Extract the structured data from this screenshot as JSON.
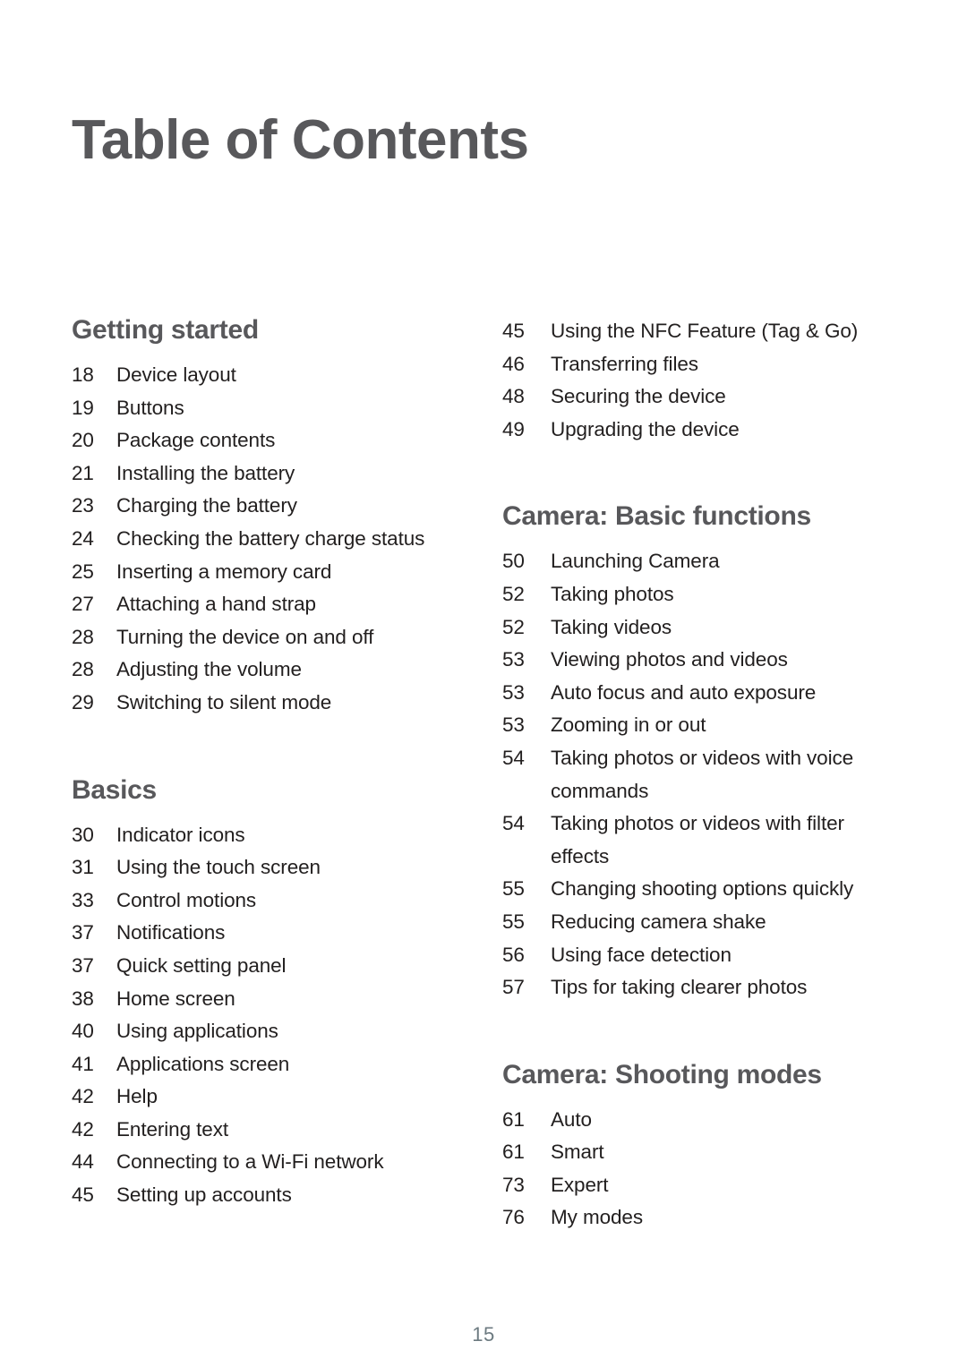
{
  "document": {
    "title": "Table of Contents",
    "folio": "15",
    "colors": {
      "heading": "#58585b",
      "body": "#221f1f",
      "folio": "#6c7a80",
      "background": "#ffffff"
    }
  },
  "columns": {
    "left": [
      {
        "heading": "Getting started",
        "entries": [
          {
            "page": "18",
            "label": "Device layout"
          },
          {
            "page": "19",
            "label": "Buttons"
          },
          {
            "page": "20",
            "label": "Package contents"
          },
          {
            "page": "21",
            "label": "Installing the battery"
          },
          {
            "page": "23",
            "label": "Charging the battery"
          },
          {
            "page": "24",
            "label": "Checking the battery charge status"
          },
          {
            "page": "25",
            "label": "Inserting a memory card"
          },
          {
            "page": "27",
            "label": "Attaching a hand strap"
          },
          {
            "page": "28",
            "label": "Turning the device on and off"
          },
          {
            "page": "28",
            "label": "Adjusting the volume"
          },
          {
            "page": "29",
            "label": "Switching to silent mode"
          }
        ]
      },
      {
        "heading": "Basics",
        "entries": [
          {
            "page": "30",
            "label": "Indicator icons"
          },
          {
            "page": "31",
            "label": "Using the touch screen"
          },
          {
            "page": "33",
            "label": "Control motions"
          },
          {
            "page": "37",
            "label": "Notifications"
          },
          {
            "page": "37",
            "label": "Quick setting panel"
          },
          {
            "page": "38",
            "label": "Home screen"
          },
          {
            "page": "40",
            "label": "Using applications"
          },
          {
            "page": "41",
            "label": "Applications screen"
          },
          {
            "page": "42",
            "label": "Help"
          },
          {
            "page": "42",
            "label": "Entering text"
          },
          {
            "page": "44",
            "label": "Connecting to a Wi-Fi network"
          },
          {
            "page": "45",
            "label": "Setting up accounts"
          }
        ]
      }
    ],
    "right": [
      {
        "heading": "",
        "entries": [
          {
            "page": "45",
            "label": "Using the NFC Feature (Tag & Go)"
          },
          {
            "page": "46",
            "label": "Transferring files"
          },
          {
            "page": "48",
            "label": "Securing the device"
          },
          {
            "page": "49",
            "label": "Upgrading the device"
          }
        ]
      },
      {
        "heading": "Camera: Basic functions",
        "entries": [
          {
            "page": "50",
            "label": "Launching Camera"
          },
          {
            "page": "52",
            "label": "Taking photos"
          },
          {
            "page": "52",
            "label": "Taking videos"
          },
          {
            "page": "53",
            "label": "Viewing photos and videos"
          },
          {
            "page": "53",
            "label": "Auto focus and auto exposure"
          },
          {
            "page": "53",
            "label": "Zooming in or out"
          },
          {
            "page": "54",
            "label": "Taking photos or videos with voice commands"
          },
          {
            "page": "54",
            "label": "Taking photos or videos with filter effects"
          },
          {
            "page": "55",
            "label": "Changing shooting options quickly"
          },
          {
            "page": "55",
            "label": "Reducing camera shake"
          },
          {
            "page": "56",
            "label": "Using face detection"
          },
          {
            "page": "57",
            "label": "Tips for taking clearer photos"
          }
        ]
      },
      {
        "heading": "Camera: Shooting modes",
        "entries": [
          {
            "page": "61",
            "label": "Auto"
          },
          {
            "page": "61",
            "label": "Smart"
          },
          {
            "page": "73",
            "label": "Expert"
          },
          {
            "page": "76",
            "label": "My modes"
          }
        ]
      }
    ]
  }
}
